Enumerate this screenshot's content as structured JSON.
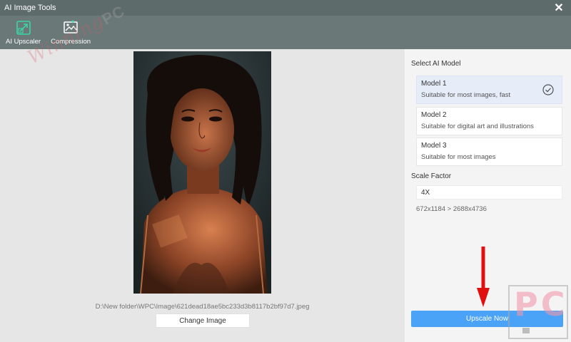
{
  "window": {
    "title": "AI Image Tools",
    "close_icon": "close-icon"
  },
  "toolbar": {
    "tools": [
      {
        "label": "AI Upscaler",
        "icon": "upscaler-icon"
      },
      {
        "label": "Compression",
        "icon": "compression-icon"
      }
    ]
  },
  "watermark": {
    "text": "Winning",
    "suffix": "PC"
  },
  "preview": {
    "file_path": "D:\\New folder\\WPC\\Image\\621dead18ae5bc233d3b8117b2bf97d7.jpeg",
    "change_label": "Change Image"
  },
  "panel": {
    "model_title": "Select AI Model",
    "models": [
      {
        "name": "Model 1",
        "desc": "Suitable for most images, fast",
        "selected": true
      },
      {
        "name": "Model 2",
        "desc": "Suitable for digital art and illustrations",
        "selected": false
      },
      {
        "name": "Model 3",
        "desc": "Suitable for most images",
        "selected": false
      }
    ],
    "scale_title": "Scale Factor",
    "scale_value": "4X",
    "resolution": "672x1184 > 2688x4736"
  },
  "actions": {
    "upscale_label": "Upscale Now"
  },
  "logo": {
    "text": "PC"
  },
  "colors": {
    "accent": "#4aa3f7",
    "titlebar": "#5e6b6b",
    "toolbar": "#6b7878",
    "arrow": "#e01010"
  }
}
